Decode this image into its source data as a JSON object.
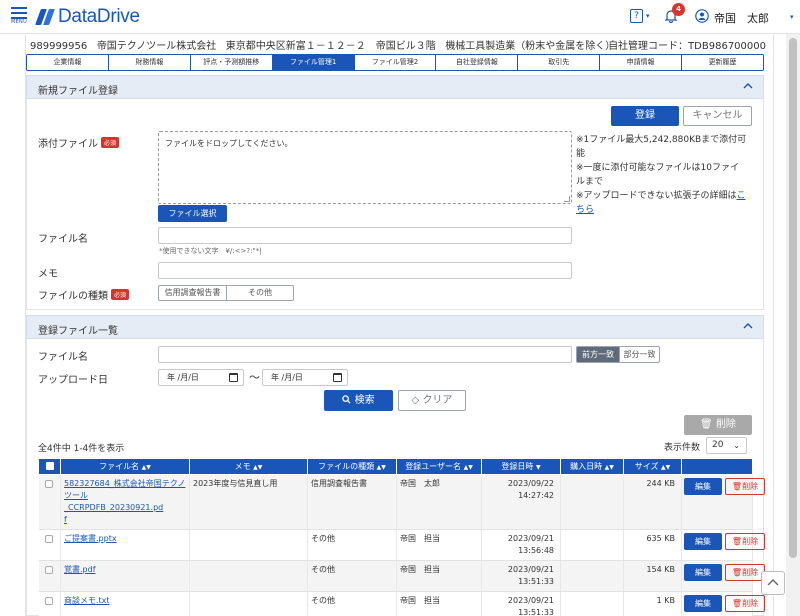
{
  "header": {
    "menu_label": "MENU",
    "logo_text": "DataDrive",
    "help_label": "?",
    "notification_count": "4",
    "user_name": "帝国　太郎",
    "brand_color": "#1a56b8"
  },
  "company": {
    "code": "989999956",
    "name": "帝国テクノツール株式会社",
    "address": "東京都中央区新富１－１２－２　帝国ビル３階",
    "industry": "機械工具製造業（粉末や金属を除く）",
    "own_code": "自社管理コード：TDB986700000"
  },
  "tabs": [
    {
      "label": "企業情報"
    },
    {
      "label": "財務情報"
    },
    {
      "label": "評点・予測額推移"
    },
    {
      "label": "ファイル管理1",
      "active": true
    },
    {
      "label": "ファイル管理2"
    },
    {
      "label": "自社登録情報"
    },
    {
      "label": "取引先"
    },
    {
      "label": "申請情報"
    },
    {
      "label": "更新履歴"
    }
  ],
  "upload": {
    "section_title": "新規ファイル登録",
    "register_label": "登録",
    "cancel_label": "キャンセル",
    "attach_label": "添付ファイル",
    "required_label": "必須",
    "drop_placeholder": "ファイルをドロップしてください。",
    "select_file_label": "ファイル選択",
    "note1": "※1ファイル最大5,242,880KBまで添付可能",
    "note1_a": "※1ファイル最大5,242,880KBまで添付可",
    "note1_b": "能",
    "note2_a": "※一度に添付可能なファイルは10ファイ",
    "note2_b": "ルまで",
    "note3_a": "※アップロードできない拡張子の詳細は",
    "note3_link_a": "こ",
    "note3_link_b": "ちら",
    "filename_label": "ファイル名",
    "filename_hint": "*使用できない文字　¥/:<>?:\"*|",
    "memo_label": "メモ",
    "type_label": "ファイルの種類",
    "type_options": [
      "信用調査報告書",
      "その他"
    ]
  },
  "list": {
    "section_title": "登録ファイル一覧",
    "filename_label": "ファイル名",
    "match_options": [
      "前方一致",
      "部分一致"
    ],
    "date_label": "アップロード日",
    "date_from_placeholder": "年 /月/日",
    "date_to_placeholder": "年 /月/日",
    "tilde": "〜",
    "search_label": "検索",
    "clear_label": "クリア",
    "bulk_delete_label": "削除",
    "count_text": "全4件中 1-4件を表示",
    "per_page_label": "表示件数",
    "per_page_value": "20",
    "columns": [
      "ファイル名",
      "メモ",
      "ファイルの種類",
      "登録ユーザー名",
      "登録日時",
      "購入日時",
      "サイズ"
    ],
    "edit_label": "編集",
    "delete_label": "削除",
    "rows": [
      {
        "filename_lines": [
          "582327684_株式会社帝国テクノ",
          "ツール_CCRPDFB_20230921.pd",
          "f"
        ],
        "memo": "2023年度与信見直し用",
        "type": "信用調査報告書",
        "user": "帝国　太郎",
        "date": "2023/09/22",
        "time": "14:27:42",
        "purchase": "",
        "size": "244 KB"
      },
      {
        "filename_lines": [
          "ご提案書.pptx"
        ],
        "memo": "",
        "type": "その他",
        "user": "帝国　担当",
        "date": "2023/09/21",
        "time": "13:56:48",
        "purchase": "",
        "size": "635 KB"
      },
      {
        "filename_lines": [
          "覚書.pdf"
        ],
        "memo": "",
        "type": "その他",
        "user": "帝国　担当",
        "date": "2023/09/21",
        "time": "13:51:33",
        "purchase": "",
        "size": "154 KB"
      },
      {
        "filename_lines": [
          "商談メモ.txt"
        ],
        "memo": "",
        "type": "その他",
        "user": "帝国　担当",
        "date": "2023/09/21",
        "time": "13:51:33",
        "purchase": "",
        "size": "1 KB"
      }
    ]
  }
}
